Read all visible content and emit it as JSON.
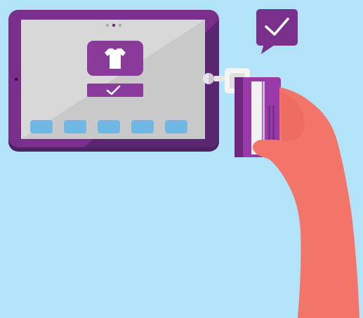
{
  "illustration": {
    "subject": "tablet-card-reader-payment",
    "icons": {
      "product": "tshirt-icon",
      "confirm": "checkmark-icon",
      "speech": "speech-bubble-checkmark-icon"
    },
    "colors": {
      "background": "#b3e3f9",
      "tablet_frame": "#7a2f8c",
      "tablet_frame_dark": "#4d2260",
      "screen": "#d8d8d8",
      "screen_shade": "#cacaca",
      "accent_purple": "#8a3a9a",
      "dock_button": "#6fb8e3",
      "card_white": "#f2f2f2",
      "card_purple": "#9a3aa8",
      "hand": "#f3756a"
    },
    "dock_button_count": 5,
    "page_dots": 3
  }
}
